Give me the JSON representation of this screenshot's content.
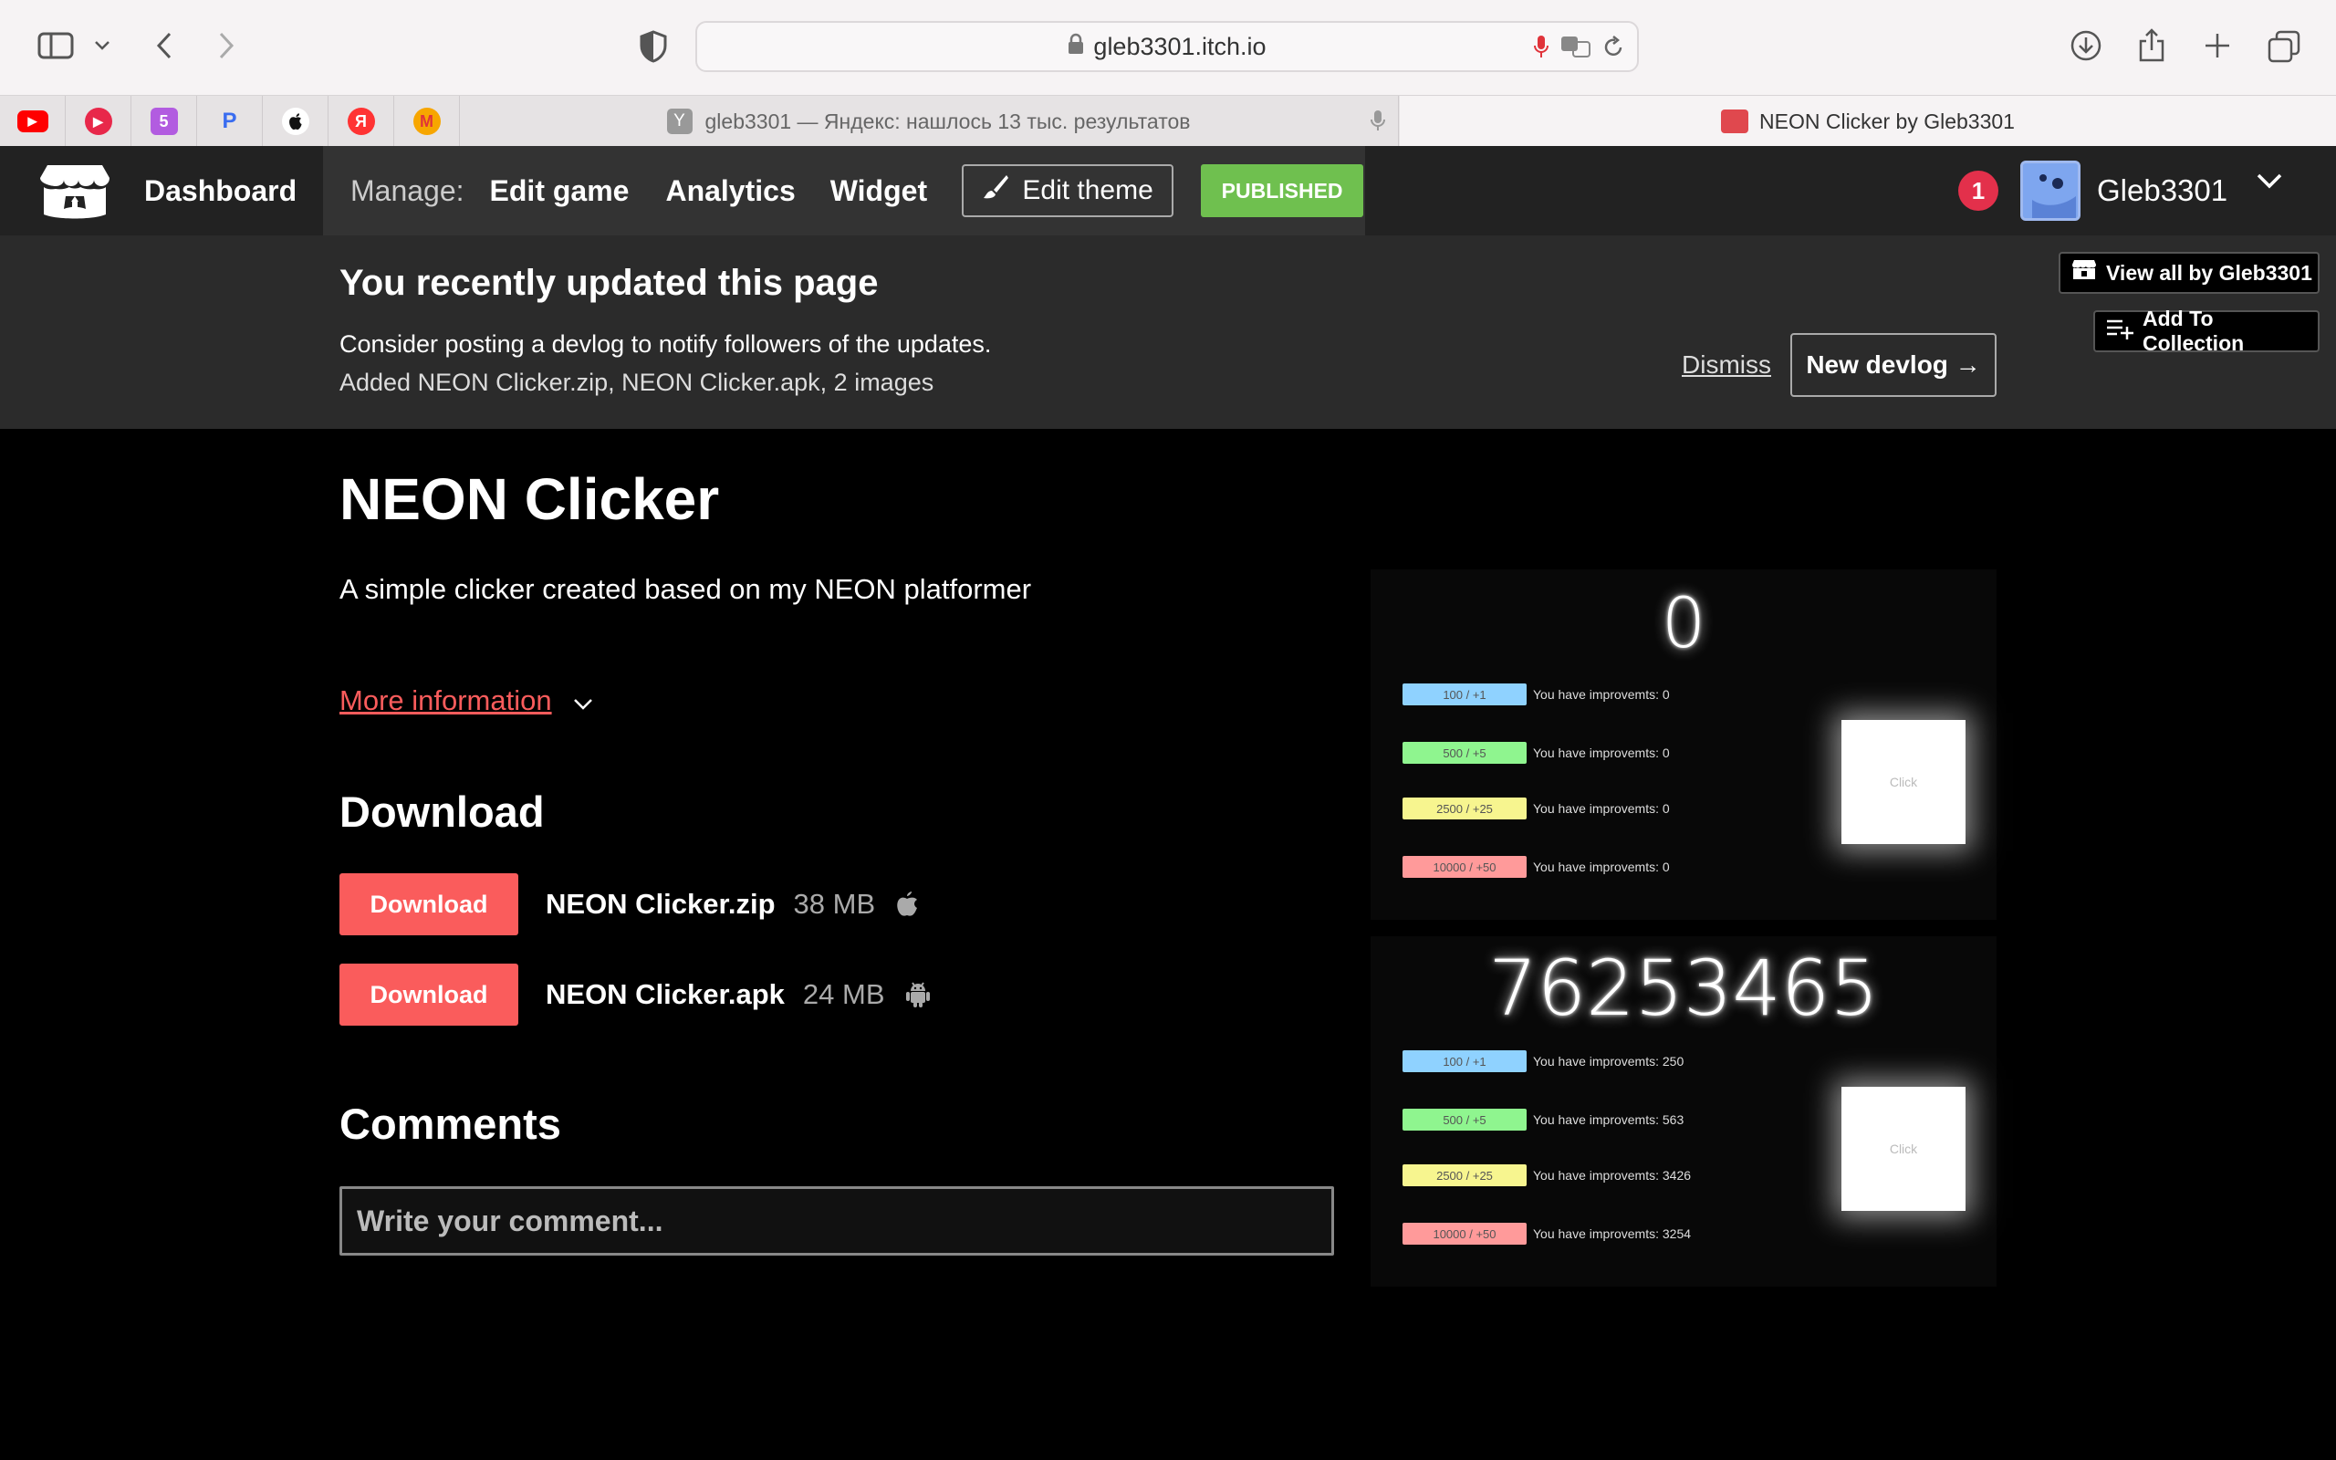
{
  "browser": {
    "url": "gleb3301.itch.io",
    "tabs": [
      {
        "title": "gleb3301 — Яндекс: нашлось 13 тыс. результатов",
        "favicon_letter": "Y"
      },
      {
        "title": "NEON Clicker by Gleb3301"
      }
    ],
    "favorites": [
      {
        "name": "youtube-favicon",
        "color": "#ff0000",
        "glyph": "▶"
      },
      {
        "name": "music-favicon",
        "color": "#e8284a",
        "glyph": "●"
      },
      {
        "name": "five-favicon",
        "color": "#b25ce0",
        "glyph": "5"
      },
      {
        "name": "p-favicon",
        "color": "#3a6df0",
        "glyph": "P"
      },
      {
        "name": "apple-favicon",
        "color": "#222222",
        "glyph": ""
      },
      {
        "name": "yandex-favicon",
        "color": "#f33",
        "glyph": "Я"
      },
      {
        "name": "market-favicon",
        "color": "#f7a600",
        "glyph": "M"
      }
    ]
  },
  "header": {
    "dashboard": "Dashboard",
    "manage_label": "Manage:",
    "links": [
      "Edit game",
      "Analytics",
      "Widget"
    ],
    "edit_theme": "Edit theme",
    "status": "PUBLISHED",
    "notifications": "1",
    "username": "Gleb3301"
  },
  "notice": {
    "title": "You recently updated this page",
    "line1": "Consider posting a devlog to notify followers of the updates.",
    "line2": "Added NEON Clicker.zip, NEON Clicker.apk, 2 images",
    "dismiss": "Dismiss",
    "new_devlog": "New devlog →"
  },
  "side": {
    "view_all": "View all by Gleb3301",
    "add_collection": "Add To Collection"
  },
  "game": {
    "title": "NEON Clicker",
    "description": "A simple clicker created based on my NEON platformer",
    "more_info": "More information"
  },
  "downloads": {
    "heading": "Download",
    "button_label": "Download",
    "files": [
      {
        "name": "NEON Clicker.zip",
        "size": "38 MB",
        "platform": "apple-icon"
      },
      {
        "name": "NEON Clicker.apk",
        "size": "24 MB",
        "platform": "android-icon"
      }
    ]
  },
  "comments": {
    "heading": "Comments",
    "placeholder": "Write your comment..."
  },
  "screenshots": [
    {
      "score": "0",
      "click_label": "Click",
      "upgrades": [
        {
          "label": "100 / +1",
          "color": "#8fd2ff",
          "text": "You have improvemts: 0"
        },
        {
          "label": "500 / +5",
          "color": "#8ff58f",
          "text": "You have improvemts: 0"
        },
        {
          "label": "2500 / +25",
          "color": "#f7f58f",
          "text": "You have improvemts: 0"
        },
        {
          "label": "10000 / +50",
          "color": "#ff9a9a",
          "text": "You have improvemts: 0"
        }
      ]
    },
    {
      "score": "76253465",
      "click_label": "Click",
      "upgrades": [
        {
          "label": "100 / +1",
          "color": "#8fd2ff",
          "text": "You have improvemts: 250"
        },
        {
          "label": "500 / +5",
          "color": "#8ff58f",
          "text": "You have improvemts: 563"
        },
        {
          "label": "2500 / +25",
          "color": "#f7f58f",
          "text": "You have improvemts: 3426"
        },
        {
          "label": "10000 / +50",
          "color": "#ff9a9a",
          "text": "You have improvemts: 3254"
        }
      ]
    }
  ],
  "colors": {
    "accent": "#fa5c5c",
    "published": "#6fc04f",
    "notification": "#e3304b"
  }
}
